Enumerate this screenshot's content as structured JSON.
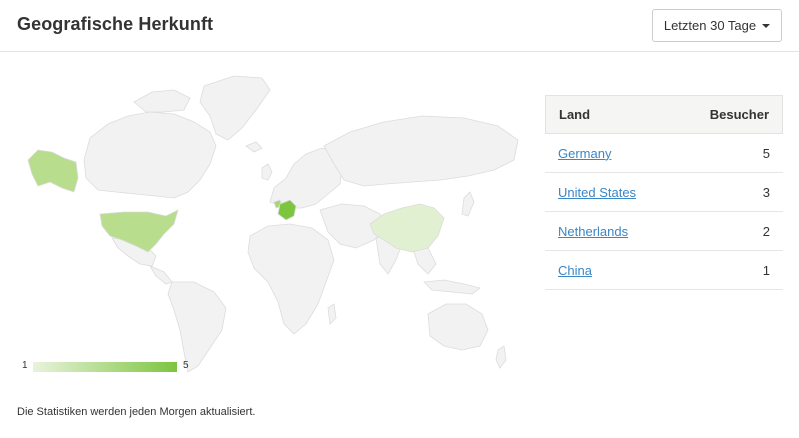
{
  "header": {
    "title": "Geografische Herkunft",
    "range_label": "Letzten 30 Tage"
  },
  "legend": {
    "min": "1",
    "max": "5"
  },
  "table": {
    "col_country": "Land",
    "col_visitors": "Besucher",
    "rows": [
      {
        "country": "Germany",
        "visitors": "5"
      },
      {
        "country": "United States",
        "visitors": "3"
      },
      {
        "country": "Netherlands",
        "visitors": "2"
      },
      {
        "country": "China",
        "visitors": "1"
      }
    ]
  },
  "footnote": "Die Statistiken werden jeden Morgen aktualisiert.",
  "colors": {
    "land": "#f2f2f2",
    "border": "#dcdcdc",
    "scale_min": "#e9f3dc",
    "scale_max": "#7cc53f",
    "link": "#3a86c6"
  }
}
